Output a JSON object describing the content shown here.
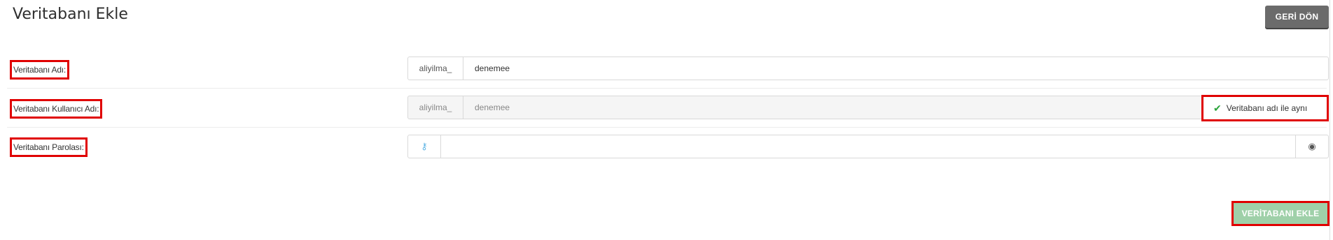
{
  "header": {
    "title": "Veritabanı Ekle",
    "back_label": "GERİ DÖN"
  },
  "form": {
    "db_name": {
      "label": "Veritabanı Adı:",
      "prefix": "aliyilma_",
      "value": "denemee"
    },
    "db_user": {
      "label": "Veritabanı Kullanıcı Adı:",
      "prefix": "aliyilma_",
      "value": "denemee",
      "same_as_name_label": "Veritabanı adı ile aynı",
      "same_as_name_checked": true
    },
    "db_password": {
      "label": "Veritabanı Parolası:",
      "value": "",
      "generate_icon": "key-icon",
      "toggle_icon": "eye-icon"
    },
    "submit_label": "VERİTABANI EKLE"
  },
  "colors": {
    "highlight": "#e00000",
    "submit_bg": "#9fd0a9",
    "back_bg": "#6b6b6b",
    "check": "#2aa33a"
  }
}
